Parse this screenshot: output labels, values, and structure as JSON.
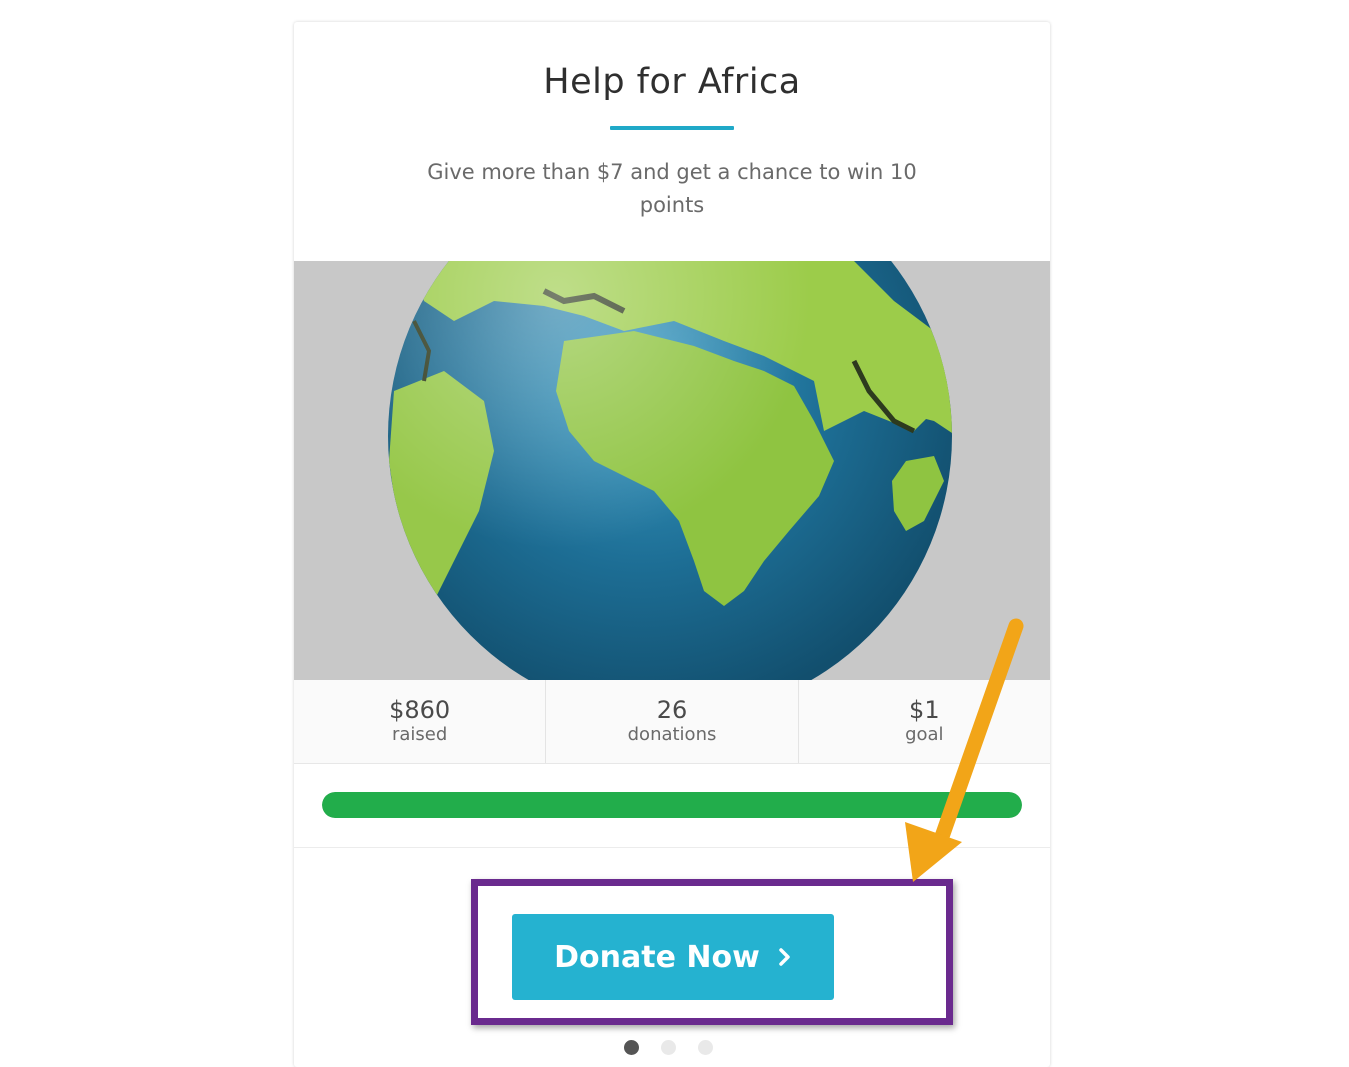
{
  "campaign": {
    "title": "Help for Africa",
    "subtitle": "Give more than $7 and get a chance to win 10 points",
    "accent_color": "#1fa9c8",
    "image": "globe-africa-image"
  },
  "stats": [
    {
      "value": "$860",
      "label": "raised"
    },
    {
      "value": "26",
      "label": "donations"
    },
    {
      "value": "$1",
      "label": "goal"
    }
  ],
  "progress": {
    "fraction": 1.0,
    "color": "#22ad4b"
  },
  "donate_button": {
    "label": "Donate Now",
    "icon": "chevron-right-icon",
    "color": "#25b2d0"
  },
  "carousel": {
    "active_index": 0,
    "count": 3
  },
  "annotations": {
    "highlight_color": "#6a2a8e",
    "arrow_color": "#f2a518"
  }
}
